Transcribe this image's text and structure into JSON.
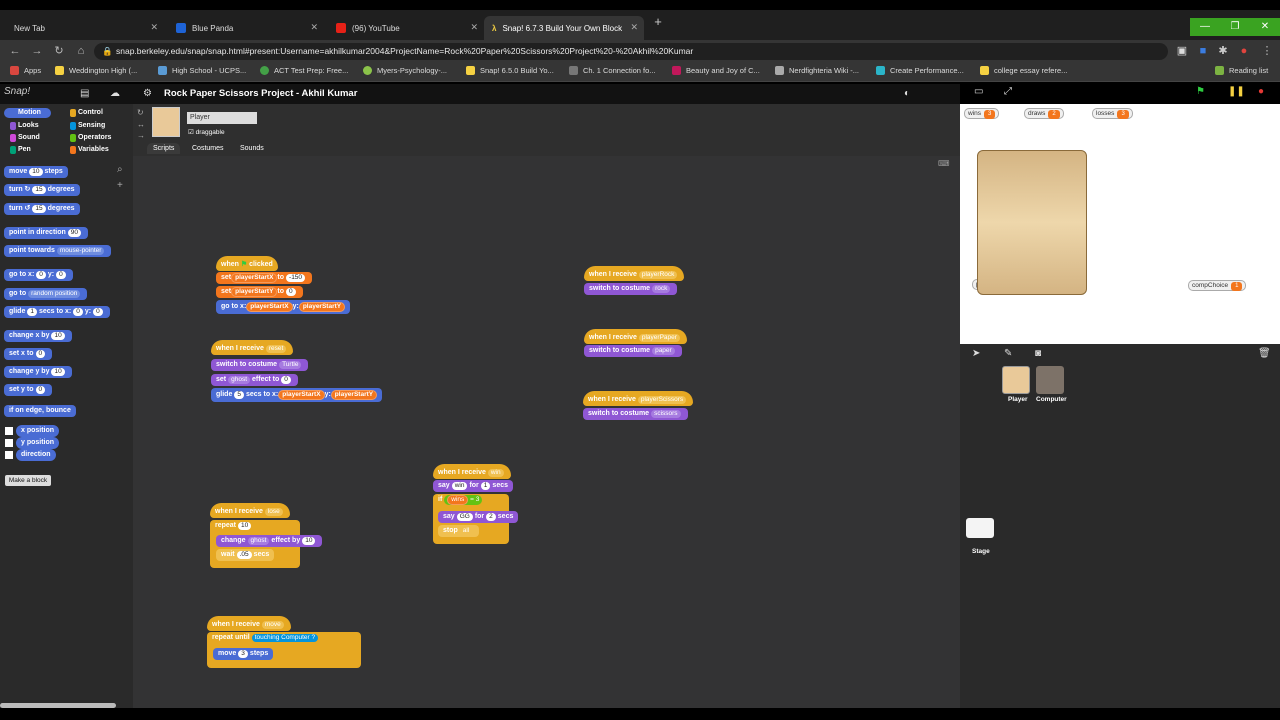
{
  "browser": {
    "tabs": [
      {
        "label": "New Tab",
        "favicon_color": "#9aa0a6"
      },
      {
        "label": "Blue Panda",
        "favicon_color": "#1e63d6"
      },
      {
        "label": "(96) YouTube",
        "favicon_color": "#e62117"
      },
      {
        "label": "Snap! 6.7.3 Build Your Own Block",
        "favicon_color": "#f5d142"
      }
    ],
    "url": "snap.berkeley.edu/snap/snap.html#present:Username=akhilkumar2004&ProjectName=Rock%20Paper%20Scissors%20Project%20-%20Akhil%20Kumar",
    "bookmarks": [
      "Apps",
      "Weddington High (...",
      "High School - UCPS...",
      "ACT Test Prep: Free...",
      "Myers-Psychology-...",
      "Snap! 6.5.0 Build Yo...",
      "Ch. 1 Connection fo...",
      "Beauty and Joy of C...",
      "Nerdfighteria Wiki -...",
      "Create Performance...",
      "college essay refere..."
    ],
    "reading_list": "Reading list"
  },
  "snap": {
    "logo": "Snap!",
    "project_title": "Rock Paper Scissors Project - Akhil Kumar",
    "categories": [
      {
        "label": "Motion",
        "color": "#4a6cd4"
      },
      {
        "label": "Looks",
        "color": "#8f57d4"
      },
      {
        "label": "Sound",
        "color": "#cf4ad9"
      },
      {
        "label": "Pen",
        "color": "#00a178"
      },
      {
        "label": "Control",
        "color": "#e6a822"
      },
      {
        "label": "Sensing",
        "color": "#0494dc"
      },
      {
        "label": "Operators",
        "color": "#62c213"
      },
      {
        "label": "Variables",
        "color": "#f3761d"
      }
    ],
    "palette": {
      "move": "move",
      "move_val": "10",
      "steps": "steps",
      "turn_cw": "turn",
      "turn_val": "15",
      "degrees": "degrees",
      "turn_ccw": "turn",
      "point_dir": "point in direction",
      "point_dir_val": "90",
      "point_towards": "point towards",
      "mouse_pointer": "mouse-pointer",
      "goto_xy": "go to x:",
      "y": "y:",
      "zero": "0",
      "goto": "go to",
      "random_position": "random position",
      "glide": "glide",
      "glide_val": "1",
      "secs_to_x": "secs to x:",
      "change_x": "change x by",
      "set_x": "set x to",
      "change_y": "change y by",
      "set_y": "set y to",
      "bounce": "if on edge, bounce",
      "x_position": "x position",
      "y_position": "y position",
      "direction": "direction",
      "make_block": "Make a block"
    },
    "sprite": {
      "name": "Player",
      "draggable_label": "draggable",
      "tabs": [
        "Scripts",
        "Costumes",
        "Sounds"
      ]
    },
    "scripts": {
      "s1_hat": "when",
      "s1_clicked": "clicked",
      "set": "set",
      "player_start_x": "playerStartX",
      "to": "to",
      "neg150": "-150",
      "player_start_y": "playerStartY",
      "zero": "0",
      "goto_x": "go to x:",
      "y": "y:",
      "when_receive": "when I receive",
      "reset": "reset",
      "switch_costume": "switch to costume",
      "turtle": "Turtle",
      "set_effect": "set",
      "ghost": "ghost",
      "effect_to": "effect to",
      "glide": "glide",
      "glide_secs": "5",
      "secs_to_x": "secs to x:",
      "lose": "lose",
      "repeat": "repeat",
      "repeat_n": "10",
      "change": "change",
      "effect_by": "effect by",
      "ten": "10",
      "wait": "wait",
      "wait_val": ".05",
      "secs": "secs",
      "move_msg": "move",
      "repeat_until": "repeat until",
      "touching": "touching",
      "computer": "Computer",
      "q": "?",
      "move": "move",
      "move_steps": "3",
      "steps": "steps",
      "win": "win",
      "say": "say",
      "say_win": "win",
      "for": "for",
      "one": "1",
      "if": "if",
      "wins": "wins",
      "eq": "=",
      "three": "3",
      "say2": "say",
      "gg": "GG",
      "two": "2",
      "stop": "stop",
      "all": "all",
      "player_rock": "playerRock",
      "rock": "rock",
      "player_paper": "playerPaper",
      "paper": "paper",
      "player_scissors": "playerScissors",
      "scissors": "scissors"
    },
    "stage": {
      "watchers": [
        {
          "label": "wins",
          "value": "3"
        },
        {
          "label": "draws",
          "value": "2"
        },
        {
          "label": "losses",
          "value": "3"
        },
        {
          "label": "playerChoice",
          "value": "2"
        },
        {
          "label": "compChoice",
          "value": "1"
        }
      ]
    },
    "corral": {
      "sprites": [
        "Player",
        "Computer"
      ],
      "stage_label": "Stage"
    },
    "colors": {
      "motion": "#4a6cd4",
      "looks": "#8f57d4",
      "control": "#e6a822",
      "variables": "#f3761d",
      "sensing": "#0494dc",
      "green_flag": "#2ecc40"
    }
  }
}
